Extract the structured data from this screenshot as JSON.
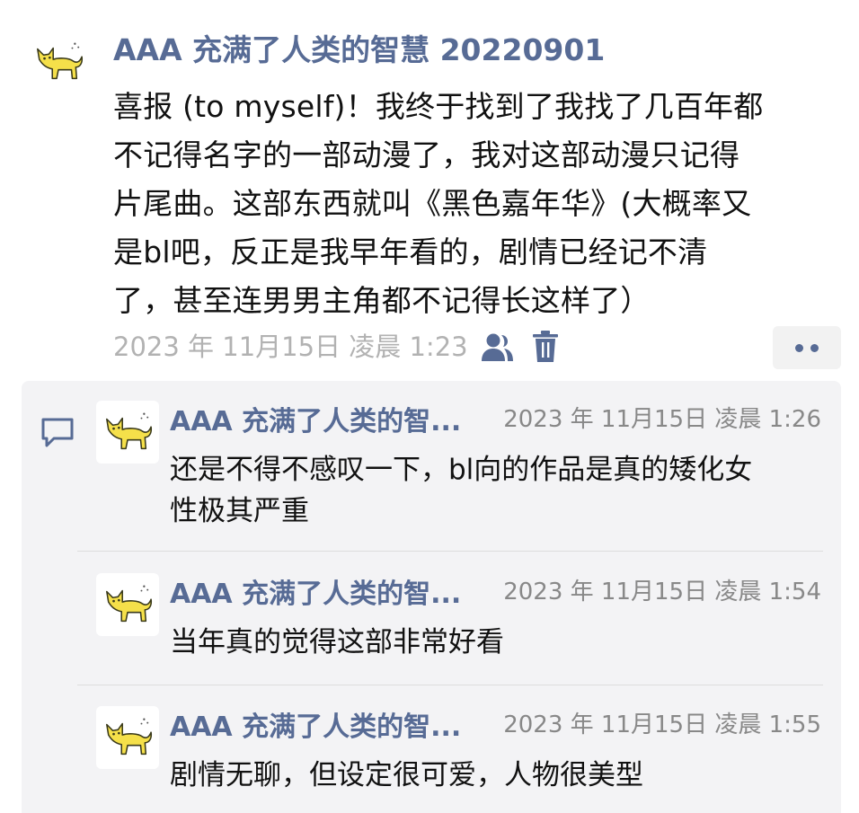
{
  "post": {
    "author": "AAA 充满了人类的智慧 20220901",
    "text_lines": [
      "喜报 (to myself)！我终于找到了我找了几百年都",
      "不记得名字的一部动漫了，我对这部动漫只记得",
      "片尾曲。这部东西就叫《黑色嘉年华》(大概率又",
      "是bl吧，反正是我早年看的，剧情已经记不清",
      "了，甚至连男男主角都不记得长这样了）"
    ],
    "time": "2023 年 11月15日 凌晨 1:23",
    "icons": {
      "avatar": "cat-avatar-icon",
      "visibility": "friends-visibility-icon",
      "delete": "trash-icon",
      "more": "more-dots-icon"
    }
  },
  "comments": [
    {
      "author": "AAA 充满了人类的智...",
      "time": "2023 年 11月15日 凌晨 1:26",
      "text_lines": [
        "还是不得不感叹一下，bl向的作品是真的矮化女",
        "性极其严重"
      ]
    },
    {
      "author": "AAA 充满了人类的智...",
      "time": "2023 年 11月15日 凌晨 1:54",
      "text_lines": [
        "当年真的觉得这部非常好看"
      ]
    },
    {
      "author": "AAA 充满了人类的智...",
      "time": "2023 年 11月15日 凌晨 1:55",
      "text_lines": [
        "剧情无聊，但设定很可爱，人物很美型"
      ]
    }
  ],
  "colors": {
    "name_blue": "#576b95",
    "meta_gray": "#b2b2b2",
    "comment_bg": "#f3f3f5",
    "avatar_cat": "#f5e04a"
  }
}
